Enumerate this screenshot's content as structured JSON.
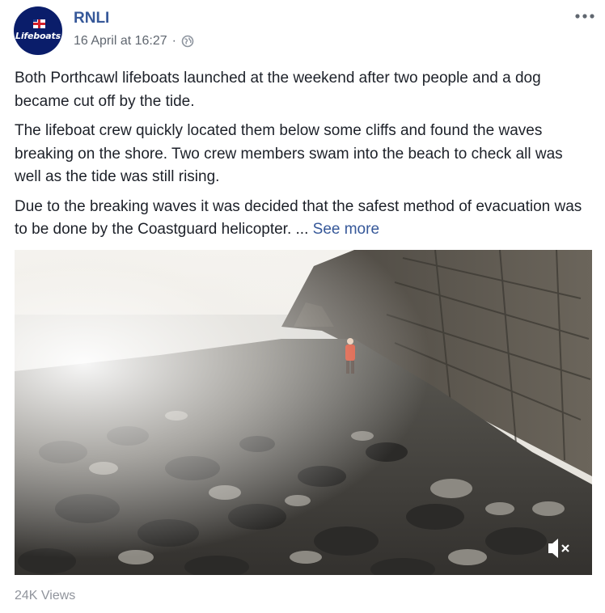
{
  "post": {
    "author": "RNLI",
    "avatar_text": "Lifeboats",
    "date": "16 April at 16:27",
    "separator": "·",
    "privacy_icon": "globe-icon",
    "more_icon": "ellipsis-icon",
    "paragraphs": [
      "Both Porthcawl lifeboats launched at the weekend after two people and a dog became cut off by the tide.",
      "The lifeboat crew quickly located them below some cliffs and found the waves breaking on the shore. Two crew members swam into the beach to check all was well as the tide was still rising.",
      "Due to the breaking waves it was decided that the safest method of evacuation was to be done by the Coastguard helicopter. ..."
    ],
    "see_more": "See more"
  },
  "video": {
    "mute_icon": "speaker-muted-icon"
  },
  "footer": {
    "views": "24K Views"
  },
  "colors": {
    "link": "#365899",
    "text": "#1d2129",
    "meta": "#606770",
    "muted": "#90949c",
    "avatar_bg": "#0a1d6a"
  }
}
